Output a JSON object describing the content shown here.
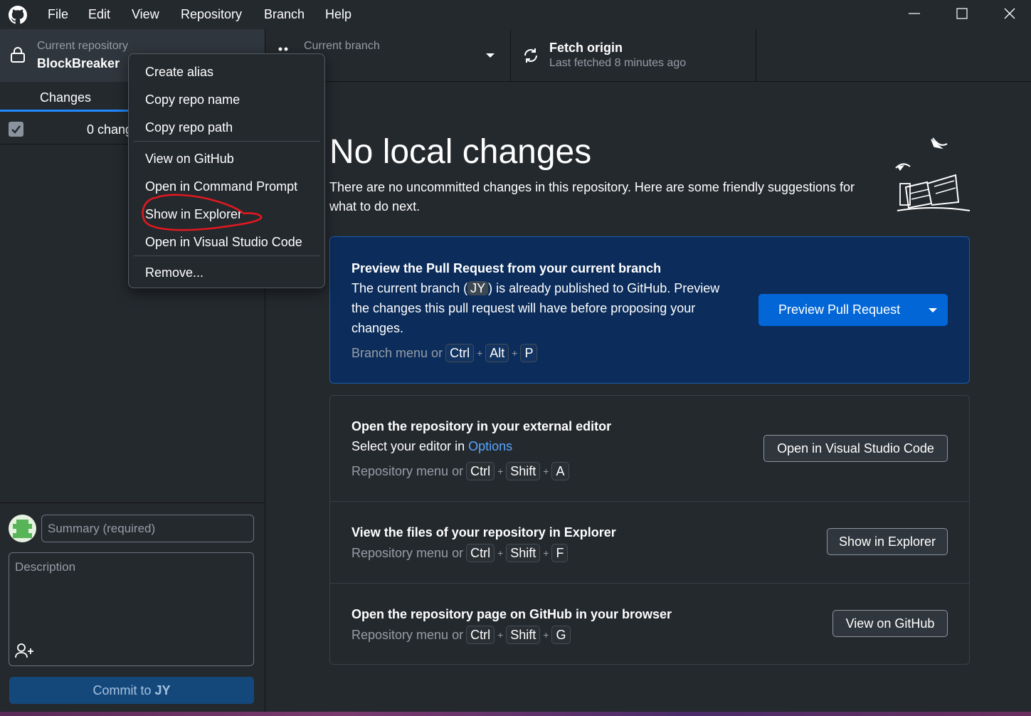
{
  "menubar": {
    "items": [
      "File",
      "Edit",
      "View",
      "Repository",
      "Branch",
      "Help"
    ]
  },
  "toolbar": {
    "repo": {
      "label": "Current repository",
      "name": "BlockBreaker"
    },
    "branch": {
      "label": "Current branch"
    },
    "fetch": {
      "title": "Fetch origin",
      "subtitle": "Last fetched 8 minutes ago"
    }
  },
  "sidebar": {
    "tab_changes": "Changes",
    "changes_count": "0 chang",
    "summary_placeholder": "Summary (required)",
    "description_placeholder": "Description",
    "commit_prefix": "Commit to ",
    "commit_branch": "JY"
  },
  "context_menu": {
    "items": [
      "Create alias",
      "Copy repo name",
      "Copy repo path",
      "View on GitHub",
      "Open in Command Prompt",
      "Show in Explorer",
      "Open in Visual Studio Code",
      "Remove..."
    ],
    "highlighted": "Show in Explorer"
  },
  "main": {
    "heading": "No local changes",
    "description": "There are no uncommitted changes in this repository. Here are some friendly suggestions for what to do next.",
    "pr_card": {
      "title": "Preview the Pull Request from your current branch",
      "text_1": "The current branch (",
      "branch": "JY",
      "text_2": ") is already published to GitHub. Preview the changes this pull request will have before proposing your changes.",
      "hint_prefix": "Branch menu or",
      "keys": [
        "Ctrl",
        "Alt",
        "P"
      ],
      "button": "Preview Pull Request"
    },
    "editor_row": {
      "title": "Open the repository in your external editor",
      "text": "Select your editor in ",
      "link": "Options",
      "hint_prefix": "Repository menu or",
      "keys": [
        "Ctrl",
        "Shift",
        "A"
      ],
      "button": "Open in Visual Studio Code"
    },
    "explorer_row": {
      "title": "View the files of your repository in Explorer",
      "hint_prefix": "Repository menu or",
      "keys": [
        "Ctrl",
        "Shift",
        "F"
      ],
      "button": "Show in Explorer"
    },
    "github_row": {
      "title": "Open the repository page on GitHub in your browser",
      "hint_prefix": "Repository menu or",
      "keys": [
        "Ctrl",
        "Shift",
        "G"
      ],
      "button": "View on GitHub"
    }
  },
  "colors": {
    "accent": "#0366d6",
    "link": "#58a6ff",
    "annotation": "#e0191f"
  }
}
